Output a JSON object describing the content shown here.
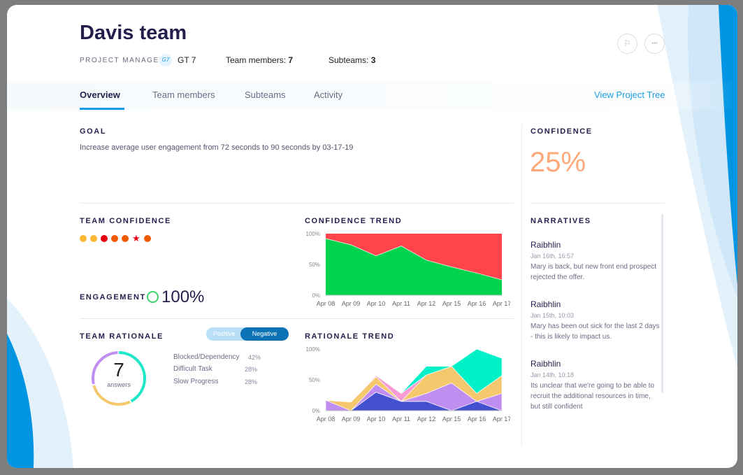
{
  "header": {
    "title": "Davis team",
    "pm_label": "PROJECT MANAGER:",
    "pm_initials": "G7",
    "pm_name": "GT 7",
    "members_label": "Team members:",
    "members_count": "7",
    "subteams_label": "Subteams:",
    "subteams_count": "3"
  },
  "actions": {
    "flag_icon": "flag-icon",
    "more_icon": "more-icon",
    "more_glyph": "•••",
    "flag_glyph": "⚐"
  },
  "tabs": [
    {
      "label": "Overview",
      "active": true
    },
    {
      "label": "Team members"
    },
    {
      "label": "Subteams"
    },
    {
      "label": "Activity"
    }
  ],
  "view_tree": "View Project Tree",
  "goal": {
    "heading": "GOAL",
    "text": "Increase average user engagement from 72 seconds to 90 seconds by 03-17-19"
  },
  "confidence": {
    "heading": "CONFIDENCE",
    "value": "25%",
    "color": "#ffa87a"
  },
  "team_confidence": {
    "heading": "TEAM CONFIDENCE",
    "dots": [
      "#fdb734",
      "#fdb734",
      "#e6000f",
      "#f05a00",
      "#f05a00",
      "star:#e6000f",
      "#f05a00"
    ]
  },
  "engagement": {
    "heading": "ENGAGEMENT",
    "value": "100%"
  },
  "rationale": {
    "heading": "TEAM RATIONALE",
    "toggle_positive": "Positive",
    "toggle_negative": "Negative",
    "answers_count": "7",
    "answers_label": "answers",
    "items": [
      {
        "label": "Blocked/Dependency",
        "pct": "42%",
        "color": "#1ee8c8"
      },
      {
        "label": "Difficult Task",
        "pct": "28%",
        "color": "#f5c86e"
      },
      {
        "label": "Slow Progress",
        "pct": "28%",
        "color": "#c08ef0"
      }
    ]
  },
  "chart_data": [
    {
      "type": "area",
      "title": "CONFIDENCE TREND",
      "stacked": true,
      "categories": [
        "Apr 08",
        "Apr 09",
        "Apr 10",
        "Apr 11",
        "Apr 12",
        "Apr 15",
        "Apr 16",
        "Apr 17"
      ],
      "yticks": [
        "0%",
        "50%",
        "100%"
      ],
      "ylim": [
        0,
        100
      ],
      "series": [
        {
          "values": [
            92,
            82,
            64,
            80,
            57,
            46,
            36,
            25
          ],
          "color": "#00d44f"
        },
        {
          "values": [
            8,
            18,
            36,
            20,
            43,
            54,
            64,
            75
          ],
          "color": "#ff444c"
        }
      ]
    },
    {
      "type": "area",
      "title": "RATIONALE TREND",
      "stacked": true,
      "categories": [
        "Apr 08",
        "Apr 09",
        "Apr 10",
        "Apr 11",
        "Apr 12",
        "Apr 15",
        "Apr 16",
        "Apr 17"
      ],
      "yticks": [
        "0%",
        "50%",
        "100%"
      ],
      "ylim": [
        0,
        100
      ],
      "series": [
        {
          "values": [
            0,
            0,
            30,
            15,
            15,
            0,
            15,
            0
          ],
          "color": "#4350d0"
        },
        {
          "values": [
            17,
            0,
            13,
            0,
            13,
            45,
            0,
            28
          ],
          "color": "#c08ef0"
        },
        {
          "values": [
            0,
            14,
            12,
            0,
            30,
            27,
            13,
            29
          ],
          "color": "#f5c86e"
        },
        {
          "values": [
            0,
            0,
            2,
            13,
            0,
            0,
            0,
            0
          ],
          "color": "#f79ad6"
        },
        {
          "values": [
            0,
            0,
            0,
            0,
            14,
            0,
            72,
            28
          ],
          "color": "#00f0c8"
        }
      ]
    }
  ],
  "narratives": {
    "heading": "NARRATIVES",
    "items": [
      {
        "author": "Raibhlin",
        "date": "Jan 16th, 16:57",
        "text": "Mary is back, but new front end prospect rejected the offer."
      },
      {
        "author": "Raibhlin",
        "date": "Jan 15th, 10:03",
        "text": "Mary has been out sick for the last 2 days - this is likely to impact us."
      },
      {
        "author": "Raibhlin",
        "date": "Jan 14th, 10:18",
        "text": "Its unclear that we're going to be able to recruit the additional resources in time, but still confident"
      }
    ]
  }
}
